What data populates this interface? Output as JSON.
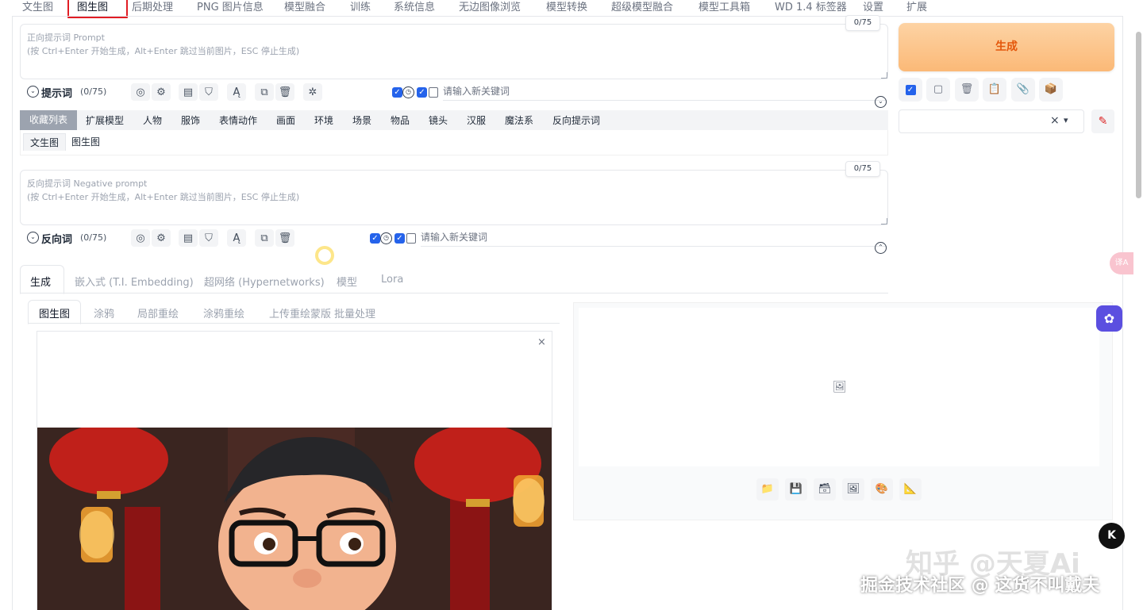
{
  "top_tabs": [
    "文生图",
    "图生图",
    "后期处理",
    "PNG 图片信息",
    "模型融合",
    "训练",
    "系统信息",
    "无边图像浏览",
    "模型转换",
    "超级模型融合",
    "模型工具箱",
    "WD 1.4 标签器",
    "设置",
    "扩展"
  ],
  "prompt": {
    "placeholder_line1": "正向提示词 Prompt",
    "placeholder_line2": "(按 Ctrl+Enter 开始生成，Alt+Enter 跳过当前图片，ESC 停止生成)",
    "counter": "0/75",
    "label": "提示词",
    "label_count": "(0/75)",
    "keyword_placeholder": "请输入新关键词"
  },
  "categories": [
    "收藏列表",
    "扩展模型",
    "人物",
    "服饰",
    "表情动作",
    "画面",
    "环境",
    "场景",
    "物品",
    "镜头",
    "汉服",
    "魔法系",
    "反向提示词"
  ],
  "sub_tabs": [
    "文生图",
    "图生图"
  ],
  "negative": {
    "placeholder_line1": "反向提示词 Negative prompt",
    "placeholder_line2": "(按 Ctrl+Enter 开始生成，Alt+Enter 跳过当前图片，ESC 停止生成)",
    "counter": "0/75",
    "label": "反向词",
    "label_count": "(0/75)",
    "keyword_placeholder": "请输入新关键词"
  },
  "generate_button": "生成",
  "style_select": {
    "clear": "×",
    "arrow": "▾"
  },
  "main_tabs": [
    "生成",
    "嵌入式 (T.I. Embedding)",
    "超网络 (Hypernetworks)",
    "模型",
    "Lora"
  ],
  "inner_tabs": [
    "图生图",
    "涂鸦",
    "局部重绘",
    "涂鸦重绘",
    "上传重绘蒙版",
    "批量处理"
  ],
  "image_close": "×",
  "watermark_1": "知乎 @天夏Ai",
  "watermark_2": "掘金技术社区 @ 这货不叫戴夫",
  "badge_k": "K",
  "translate_badge": "译A"
}
